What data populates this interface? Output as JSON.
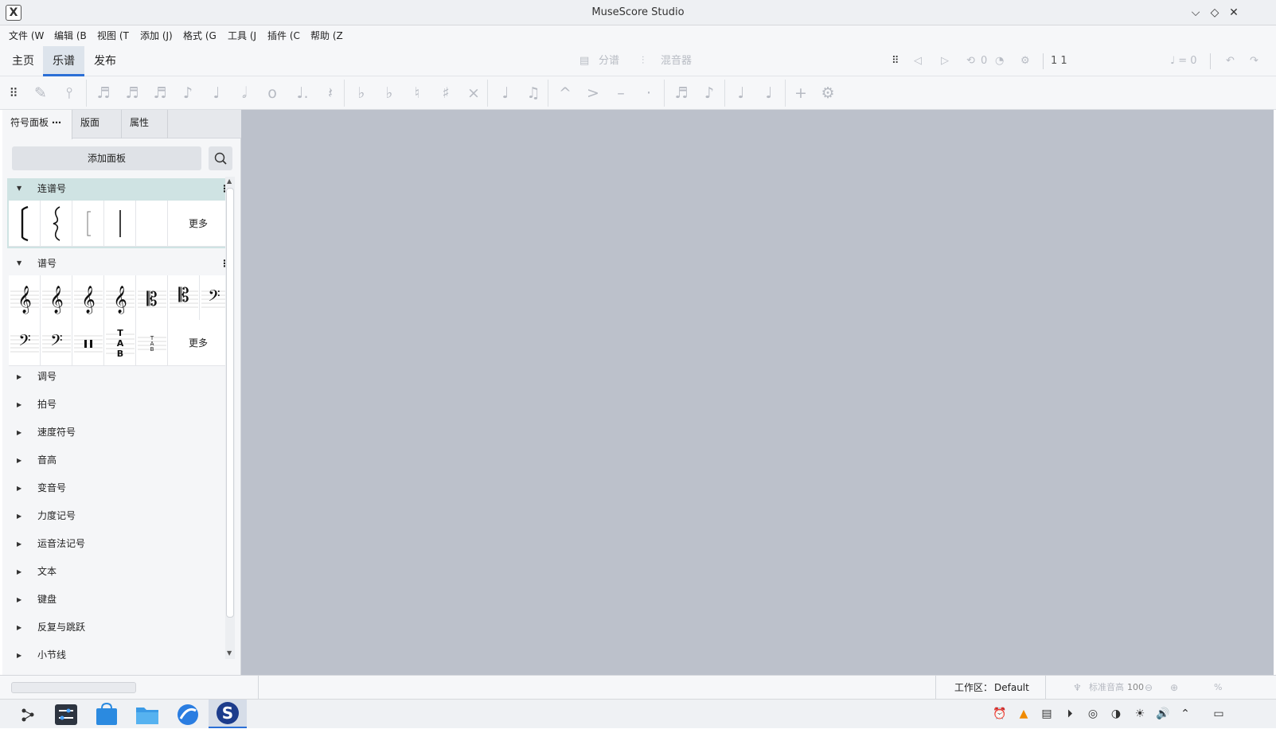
{
  "window": {
    "title": "MuseScore Studio"
  },
  "menu": [
    "文件 (W",
    "编辑 (B",
    "视图 (T",
    "添加 (J)",
    "格式 (G",
    "工具 (J",
    "插件 (C",
    "帮助 (Z"
  ],
  "tabs": [
    "主页",
    "乐谱",
    "发布"
  ],
  "playback": {
    "parts": "分谱",
    "mixer": "混音器",
    "position": "1  1",
    "tempo": "♩ = 0",
    "counter": "0"
  },
  "panel": {
    "tabs": [
      "符号面板",
      "版面",
      "属性"
    ],
    "add_palette": "添加面板",
    "sections_open": [
      {
        "label": "连谱号"
      },
      {
        "label": "谱号"
      }
    ],
    "more": "更多",
    "sections_closed": [
      "调号",
      "拍号",
      "速度符号",
      "音高",
      "变音号",
      "力度记号",
      "运音法记号",
      "文本",
      "键盘",
      "反复与跳跃",
      "小节线"
    ]
  },
  "status": {
    "workspace_label": "工作区：",
    "workspace_value": "Default",
    "pitch_label": "标准音高",
    "zoom": "100",
    "percent": "%"
  },
  "colors": {
    "accent": "#2b6fd6",
    "canvas": "#bcc1cb",
    "section_highlight": "#cfe3e3"
  }
}
